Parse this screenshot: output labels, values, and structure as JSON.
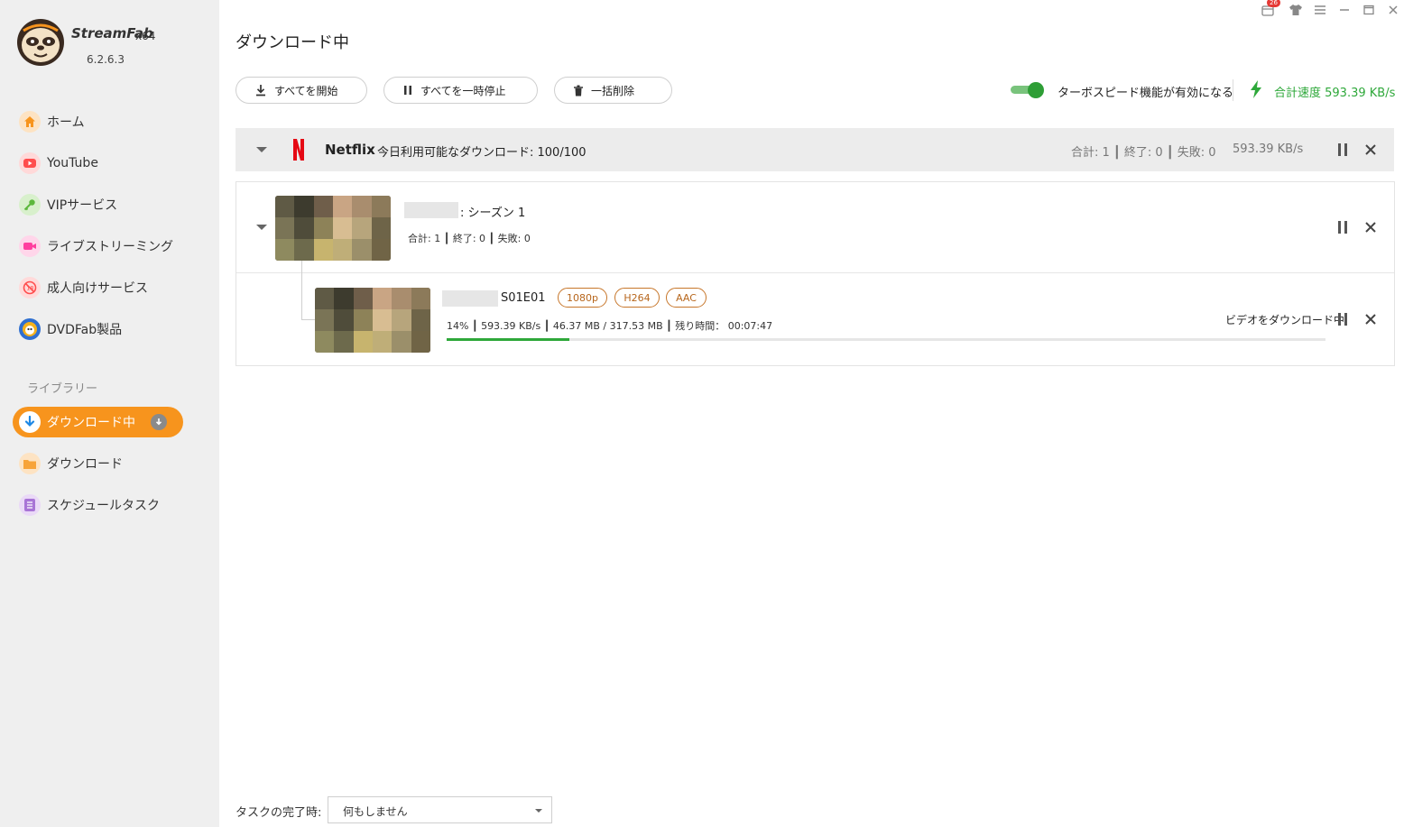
{
  "app": {
    "brand": "StreamFab",
    "arch": "x64",
    "version": "6.2.6.3",
    "notification_count": "26"
  },
  "sidebar": {
    "items": [
      {
        "label": "ホーム",
        "icon": "home-icon",
        "color": "#f7941d"
      },
      {
        "label": "YouTube",
        "icon": "youtube-icon",
        "color": "#ff4d4d"
      },
      {
        "label": "VIPサービス",
        "icon": "key-icon",
        "color": "#6cc04a"
      },
      {
        "label": "ライブストリーミング",
        "icon": "camera-icon",
        "color": "#ff4fa3"
      },
      {
        "label": "成人向けサービス",
        "icon": "adult-18-icon",
        "color": "#ff5a5a"
      },
      {
        "label": "DVDFab製品",
        "icon": "dvdfab-icon",
        "color": "#3b7bd6"
      }
    ],
    "library_label": "ライブラリー",
    "library_items": [
      {
        "label": "ダウンロード中",
        "icon": "download-icon",
        "active": true
      },
      {
        "label": "ダウンロード",
        "icon": "folder-icon",
        "color": "#f7a43a"
      },
      {
        "label": "スケジュールタスク",
        "icon": "schedule-icon",
        "color": "#a874d6"
      }
    ]
  },
  "main": {
    "title": "ダウンロード中",
    "toolbar": {
      "start_all": "すべてを開始",
      "pause_all": "すべてを一時停止",
      "delete_all": "一括削除"
    },
    "turbo": {
      "label": "ターボスピード機能が有効になる",
      "enabled": true
    },
    "total_speed": "合計速度 593.39 KB/s",
    "group": {
      "service": "Netflix",
      "quota": "今日利用可能なダウンロード: 100/100",
      "stats": "合計: 1 ┃ 終了: 0 ┃ 失敗: 0",
      "speed": "593.39 KB/s"
    },
    "season": {
      "title": ": シーズン 1",
      "stats": "合計: 1 ┃  終了: 0 ┃  失敗: 0"
    },
    "episode": {
      "title": "S01E01",
      "tags": [
        "1080p",
        "H264",
        "AAC"
      ],
      "progress_text": "14% ┃  593.39 KB/s ┃  46.37 MB / 317.53 MB ┃  残り時間：  00:07:47",
      "progress": 0.14,
      "status": "ビデオをダウンロード中"
    }
  },
  "footer": {
    "label": "タスクの完了時:",
    "select_value": "何もしません"
  }
}
